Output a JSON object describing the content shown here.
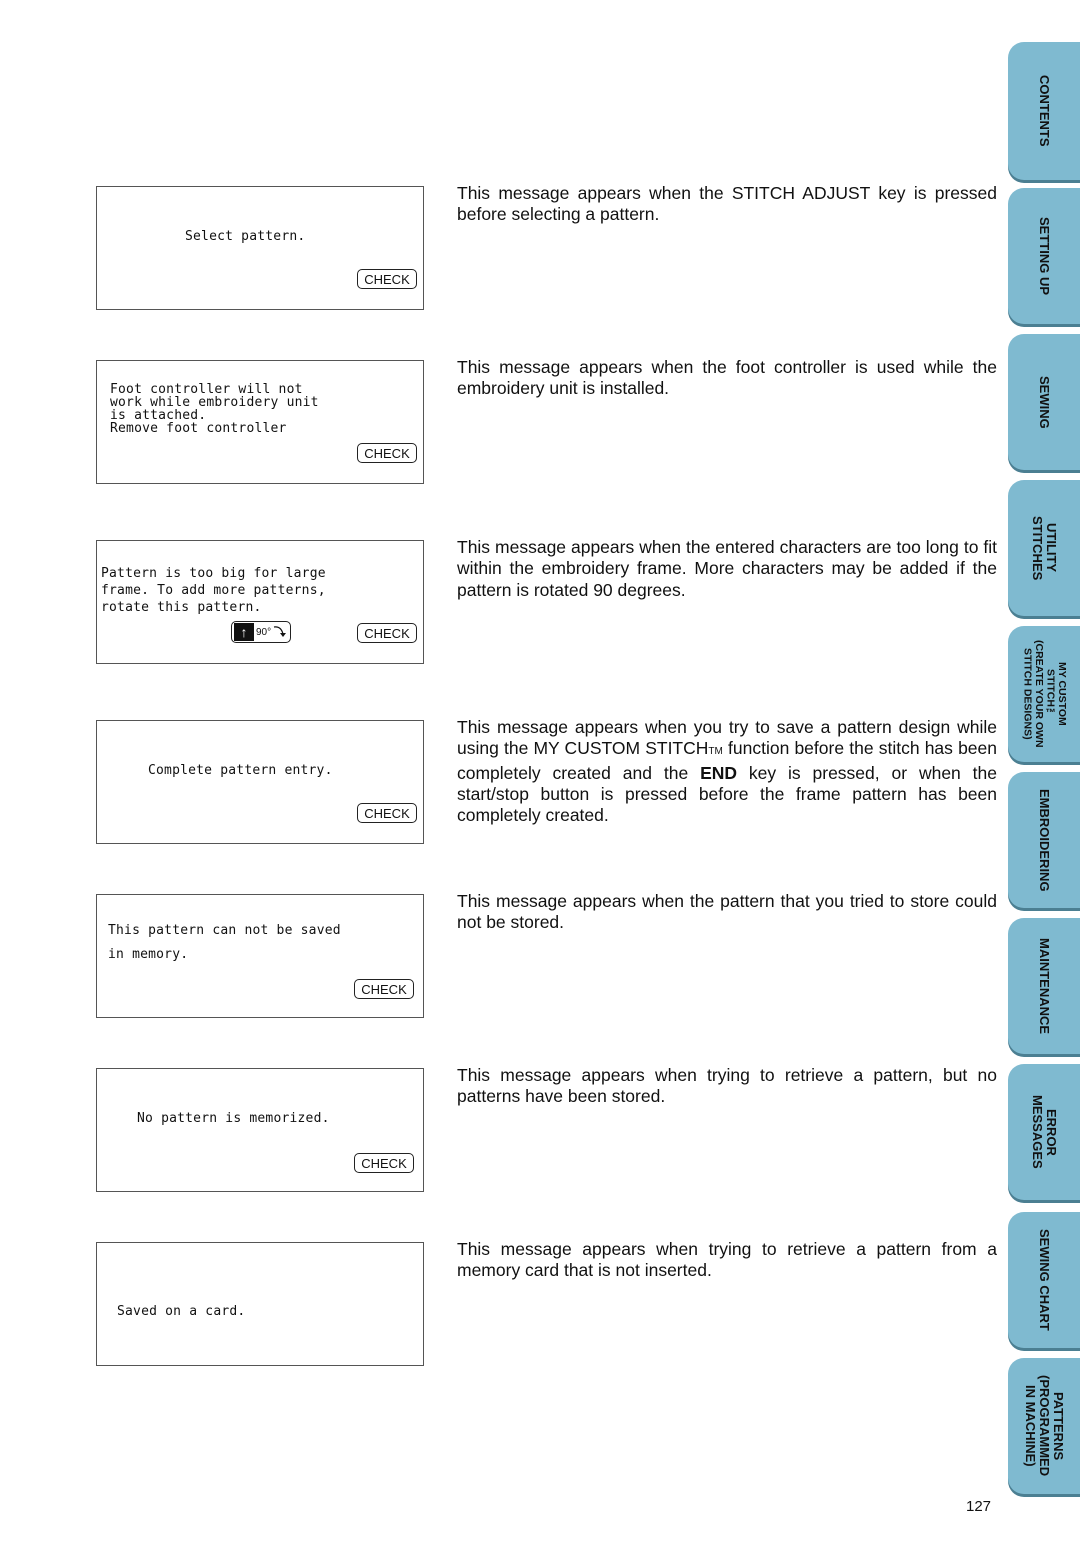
{
  "entries": [
    {
      "screen_lines": [
        "Select pattern."
      ],
      "check_label": "CHECK",
      "description": "This message appears when the STITCH ADJUST key is pressed before selecting a pattern."
    },
    {
      "screen_lines": [
        "Foot controller will not",
        "work while embroidery unit",
        "is attached.",
        "Remove foot controller"
      ],
      "check_label": "CHECK",
      "description": "This message appears when the foot controller is used while the embroidery unit is installed."
    },
    {
      "screen_lines": [
        "Pattern is too big for large",
        "frame. To add more patterns,",
        "rotate this pattern."
      ],
      "rotate_label": "90°",
      "check_label": "CHECK",
      "description": "This message appears when the entered characters are too long to fit within the embroidery frame. More characters may be added if the pattern is rotated 90 degrees."
    },
    {
      "screen_lines": [
        "Complete pattern entry."
      ],
      "check_label": "CHECK",
      "description_parts": {
        "a": "This message appears when you try to save a pattern design while using the MY CUSTOM STITCH",
        "tm": "TM",
        "b": " function before the stitch has been completely created and the ",
        "bold": "END",
        "c": " key is pressed, or when the start/stop button is pressed before the frame pattern has been completely created."
      }
    },
    {
      "screen_lines": [
        "This pattern can not be saved",
        "in memory."
      ],
      "check_label": "CHECK",
      "description": "This message appears when the pattern that you tried to store could not be stored."
    },
    {
      "screen_lines": [
        "No pattern is memorized."
      ],
      "check_label": "CHECK",
      "description": "This message appears when trying to retrieve a pattern, but no patterns have been stored."
    },
    {
      "screen_lines": [
        "Saved on a card."
      ],
      "description": "This message appears when trying to retrieve a pattern from a memory card that is not inserted."
    }
  ],
  "tabs": [
    {
      "label": "CONTENTS"
    },
    {
      "label": "SETTING UP"
    },
    {
      "label": "SEWING"
    },
    {
      "label": "UTILITY\nSTITCHES"
    },
    {
      "label": "MY CUSTOM\nSTITCH™\n(CREATE YOUR OWN\nSTITCH DESIGNS)"
    },
    {
      "label": "EMBROIDERING"
    },
    {
      "label": "MAINTENANCE"
    },
    {
      "label": "ERROR\nMESSAGES"
    },
    {
      "label": "SEWING CHART"
    },
    {
      "label": "PATTERNS\n(PROGRAMMED\nIN MACHINE)"
    }
  ],
  "colors": {
    "tab_fill": "#7fbad0",
    "tab_shadow": "#4b7f92"
  },
  "page_number": "127"
}
